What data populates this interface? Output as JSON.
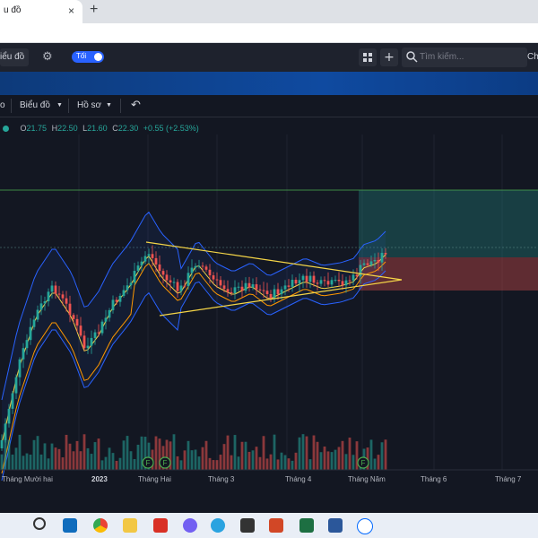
{
  "browser": {
    "tab_title": "u đồ",
    "tab_close": "×",
    "new_tab": "+"
  },
  "header": {
    "chart_button": "iểu đồ",
    "theme_label": "Tối",
    "search_placeholder": "Tìm kiếm...",
    "search_trailing": "Ch"
  },
  "menu": {
    "left_fragment": "o",
    "chart": "Biểu đồ",
    "profile": "Hồ sơ",
    "undo": "↶"
  },
  "legend": {
    "open": "21.75",
    "high": "22.50",
    "low": "21.60",
    "close": "22.30",
    "change": "+0.55 (+2.53%)",
    "prefix_o": "O",
    "prefix_h": "H",
    "prefix_l": "L",
    "prefix_c": "C"
  },
  "chart_data": {
    "type": "candlestick",
    "x_ticks": [
      "Tháng Mười hai",
      "2023",
      "Tháng Hai",
      "Tháng 3",
      "Tháng 4",
      "Tháng Năm",
      "Tháng 6",
      "Tháng 7"
    ],
    "last": {
      "open": 21.75,
      "high": 22.5,
      "low": 21.6,
      "close": 22.3
    },
    "dividend_markers": [
      "F",
      "F",
      "F"
    ],
    "colors": {
      "up": "#26a69a",
      "down": "#ef5350",
      "trend": "#f5d547",
      "bands": "#2962ff"
    }
  },
  "taskbar": {
    "icons": [
      "search-icon",
      "outlook-icon",
      "chrome-icon",
      "files-icon",
      "app-red-icon",
      "viber-icon",
      "telegram-icon",
      "screenshot-icon",
      "powerpoint-icon",
      "excel-icon",
      "word-icon",
      "zalo-icon"
    ]
  }
}
